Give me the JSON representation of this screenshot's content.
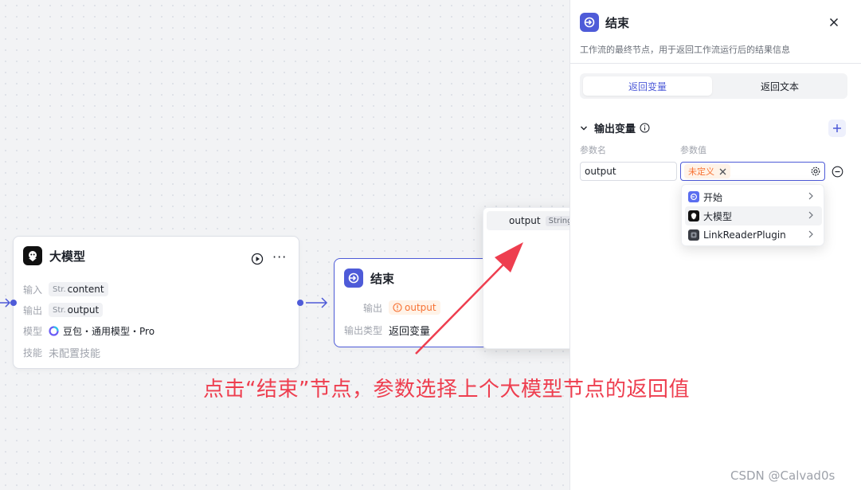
{
  "llm_node": {
    "title": "大模型",
    "rows": [
      {
        "label": "输入",
        "type": "Str.",
        "value": "content"
      },
      {
        "label": "输出",
        "type": "Str.",
        "value": "output"
      }
    ],
    "model_label": "模型",
    "model_value": "豆包・通用模型・Pro",
    "skill_label": "技能",
    "skill_value": "未配置技能"
  },
  "end_node": {
    "title": "结束",
    "output_label": "输出",
    "output_value": "output",
    "output_type_label": "输出类型",
    "output_type_value": "返回变量"
  },
  "var_popup": {
    "item_name": "output",
    "item_type": "String"
  },
  "annotation": {
    "text": "点击“结束”节点，参数选择上个大模型节点的返回值",
    "color": "#ee3e4f"
  },
  "panel": {
    "title": "结束",
    "description": "工作流的最终节点，用于返回工作流运行后的结果信息",
    "tabs": [
      "返回变量",
      "返回文本"
    ],
    "section_title": "输出变量",
    "col_name": "参数名",
    "col_value": "参数值",
    "param_name_value": "output",
    "param_value_tag": "未定义"
  },
  "source_menu": {
    "items": [
      "开始",
      "大模型",
      "LinkReaderPlugin"
    ]
  },
  "watermark": "CSDN @Calvad0s",
  "colors": {
    "accent": "#4e5bd8",
    "warning": "#f77234",
    "warning_bg": "#fff3e8"
  }
}
